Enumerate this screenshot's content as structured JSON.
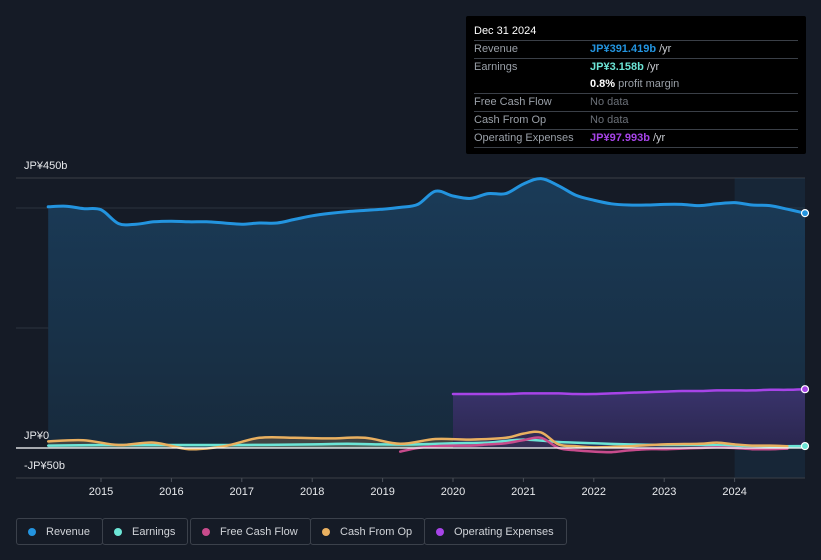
{
  "tooltip": {
    "date": "Dec 31 2024",
    "rows": [
      {
        "key": "Revenue",
        "value": "JP¥391.419b",
        "unit": " /yr",
        "color": "#2394df"
      },
      {
        "key": "Earnings",
        "value": "JP¥3.158b",
        "unit": " /yr",
        "color": "#6ce5d6"
      },
      {
        "key": "",
        "value": "0.8%",
        "unit": " profit margin",
        "color": "#ffffff"
      },
      {
        "key": "Free Cash Flow",
        "value": "No data",
        "unit": "",
        "color": "#6b7078"
      },
      {
        "key": "Cash From Op",
        "value": "No data",
        "unit": "",
        "color": "#6b7078"
      },
      {
        "key": "Operating Expenses",
        "value": "JP¥97.993b",
        "unit": " /yr",
        "color": "#a744e8"
      }
    ]
  },
  "legend": [
    {
      "label": "Revenue",
      "color": "#2394df"
    },
    {
      "label": "Earnings",
      "color": "#6ce5d6"
    },
    {
      "label": "Free Cash Flow",
      "color": "#c84b8c"
    },
    {
      "label": "Cash From Op",
      "color": "#e9b060"
    },
    {
      "label": "Operating Expenses",
      "color": "#a744e8"
    }
  ],
  "chart_data": {
    "type": "area",
    "title": "",
    "xlabel": "",
    "ylabel": "",
    "ylim": [
      -50,
      450
    ],
    "yticks": [
      {
        "value": 450,
        "label": "JP¥450b"
      },
      {
        "value": 0,
        "label": "JP¥0"
      },
      {
        "value": -50,
        "label": "-JP¥50b"
      }
    ],
    "gridlines": [
      400,
      200
    ],
    "xlim": [
      2014.25,
      2025.0
    ],
    "xticks": [
      2015,
      2016,
      2017,
      2018,
      2019,
      2020,
      2021,
      2022,
      2023,
      2024
    ],
    "highlight_range": [
      2024.0,
      2025.0
    ],
    "series": [
      {
        "name": "Revenue",
        "color": "#2394df",
        "x": [
          2014.25,
          2014.5,
          2014.75,
          2015.0,
          2015.25,
          2015.5,
          2015.75,
          2016.0,
          2016.25,
          2016.5,
          2016.75,
          2017.0,
          2017.25,
          2017.5,
          2017.75,
          2018.0,
          2018.25,
          2018.5,
          2018.75,
          2019.0,
          2019.25,
          2019.5,
          2019.75,
          2020.0,
          2020.25,
          2020.5,
          2020.75,
          2021.0,
          2021.25,
          2021.5,
          2021.75,
          2022.0,
          2022.25,
          2022.5,
          2022.75,
          2023.0,
          2023.25,
          2023.5,
          2023.75,
          2024.0,
          2024.25,
          2024.5,
          2024.75,
          2025.0
        ],
        "values": [
          402,
          403,
          399,
          397,
          374,
          373,
          377,
          378,
          377,
          377,
          375,
          373,
          375,
          375,
          381,
          387,
          391,
          394,
          396,
          398,
          401,
          406,
          428,
          420,
          416,
          424,
          424,
          440,
          449,
          437,
          421,
          413,
          407,
          405,
          405,
          406,
          406,
          404,
          407,
          409,
          405,
          404,
          398,
          391.4
        ],
        "marker_last": true
      },
      {
        "name": "Earnings",
        "color": "#6ce5d6",
        "x": [
          2014.25,
          2015.0,
          2016.0,
          2017.0,
          2018.0,
          2018.5,
          2019.0,
          2019.5,
          2020.0,
          2020.5,
          2021.0,
          2021.5,
          2022.0,
          2022.5,
          2023.0,
          2023.5,
          2024.0,
          2024.5,
          2025.0
        ],
        "values": [
          4,
          5,
          5,
          5,
          6,
          7,
          6,
          6,
          8,
          9,
          14,
          10,
          8,
          6,
          5,
          5,
          4,
          3,
          3.2
        ],
        "marker_last": true
      },
      {
        "name": "Free Cash Flow",
        "color": "#c84b8c",
        "x": [
          2019.25,
          2019.5,
          2019.75,
          2020.0,
          2020.25,
          2020.5,
          2020.75,
          2021.0,
          2021.25,
          2021.5,
          2021.75,
          2022.0,
          2022.25,
          2022.5,
          2022.75,
          2023.0,
          2023.25,
          2023.5,
          2023.75,
          2024.0,
          2024.25,
          2024.5,
          2024.75
        ],
        "values": [
          -6,
          0,
          3,
          4,
          4,
          6,
          8,
          13,
          17,
          0,
          -4,
          -6,
          -7,
          -4,
          -2,
          -2,
          -1,
          0,
          1,
          0,
          -2,
          -2,
          -1
        ],
        "marker_last": false
      },
      {
        "name": "Cash From Op",
        "color": "#e9b060",
        "x": [
          2014.25,
          2014.75,
          2015.25,
          2015.75,
          2016.25,
          2016.75,
          2017.25,
          2017.75,
          2018.25,
          2018.75,
          2019.25,
          2019.75,
          2020.25,
          2020.75,
          2021.0,
          2021.25,
          2021.5,
          2021.75,
          2022.0,
          2022.5,
          2023.0,
          2023.5,
          2023.75,
          2024.0,
          2024.25,
          2024.5,
          2024.75
        ],
        "values": [
          11,
          13,
          5,
          9,
          -2,
          3,
          17,
          17,
          16,
          17,
          7,
          15,
          14,
          17,
          24,
          26,
          6,
          3,
          1,
          3,
          6,
          7,
          9,
          6,
          4,
          4,
          3
        ],
        "marker_last": false
      },
      {
        "name": "Operating Expenses",
        "color": "#a744e8",
        "x": [
          2020.0,
          2020.25,
          2020.5,
          2020.75,
          2021.0,
          2021.25,
          2021.5,
          2021.75,
          2022.0,
          2022.25,
          2022.5,
          2022.75,
          2023.0,
          2023.25,
          2023.5,
          2023.75,
          2024.0,
          2024.25,
          2024.5,
          2024.75,
          2025.0
        ],
        "values": [
          90,
          90,
          90,
          90,
          91,
          91,
          91,
          90,
          90,
          91,
          92,
          93,
          94,
          95,
          95,
          96,
          96,
          96,
          97,
          97,
          98.0
        ],
        "marker_last": true
      }
    ]
  }
}
